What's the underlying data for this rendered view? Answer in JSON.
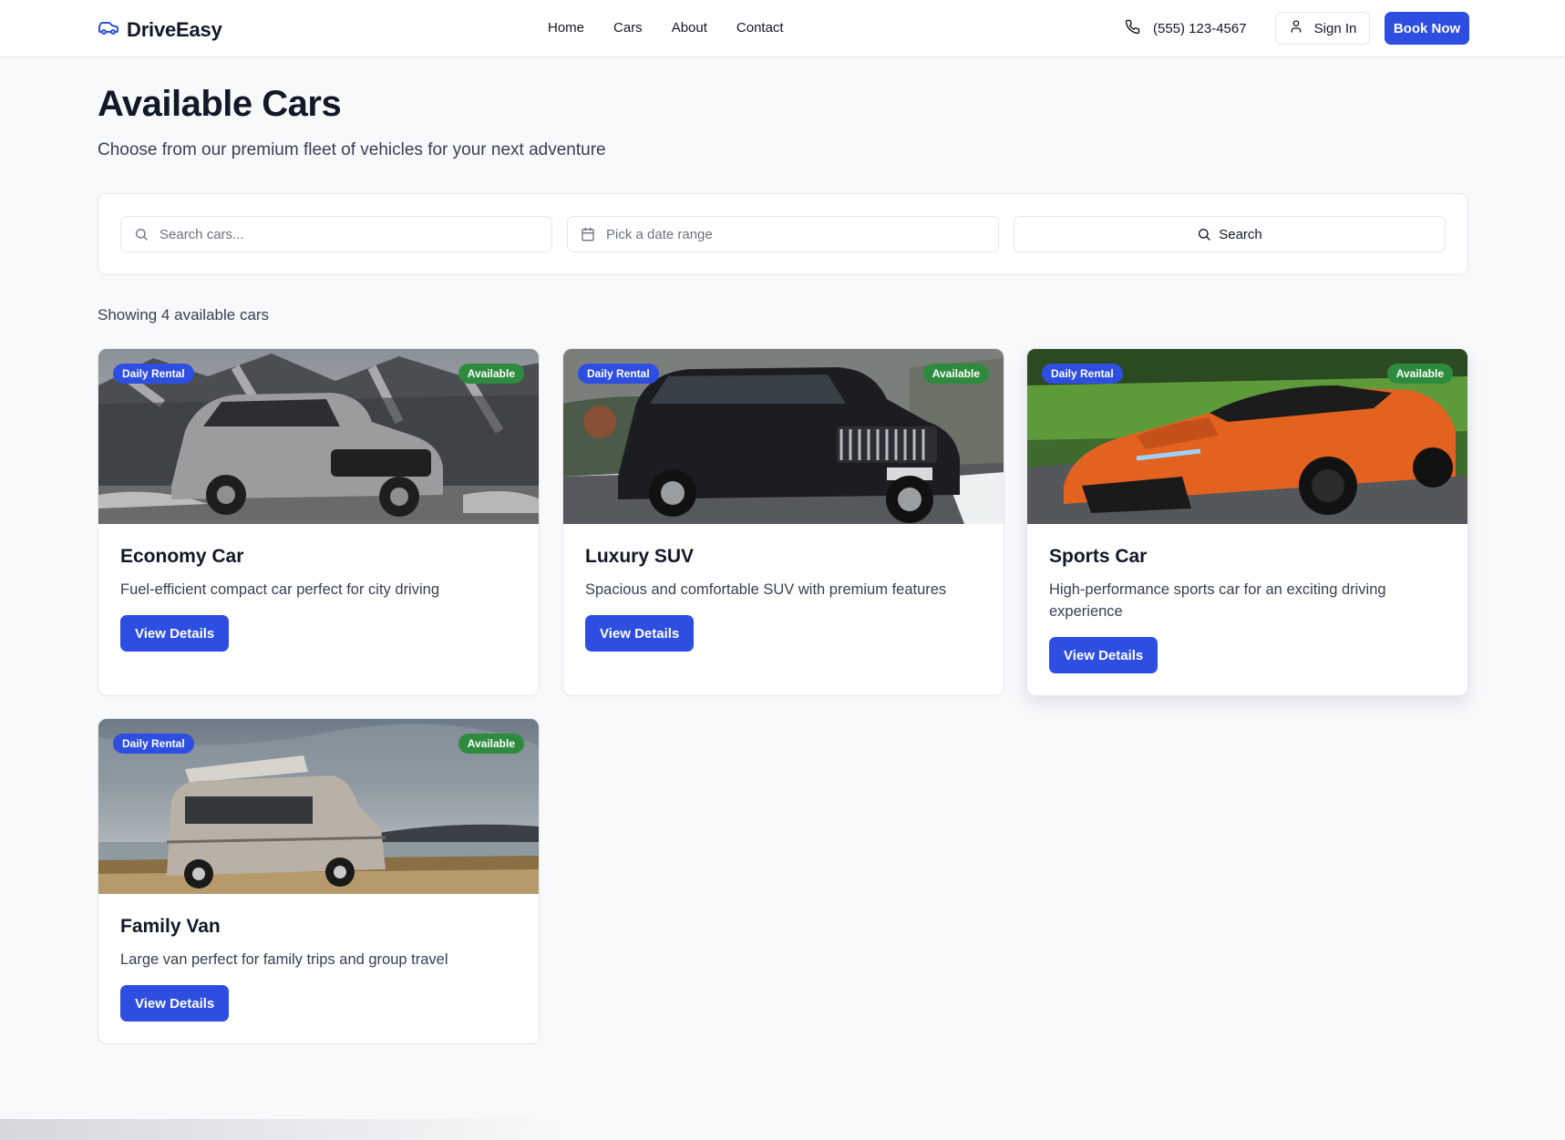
{
  "header": {
    "brand": "DriveEasy",
    "nav": [
      "Home",
      "Cars",
      "About",
      "Contact"
    ],
    "phone": "(555) 123-4567",
    "sign_in": "Sign In",
    "book_now": "Book Now"
  },
  "main": {
    "title": "Available Cars",
    "subtitle": "Choose from our premium fleet of vehicles for your next adventure",
    "count_text": "Showing 4 available cars"
  },
  "search": {
    "placeholder": "Search cars...",
    "date_placeholder": "Pick a date range",
    "button": "Search"
  },
  "cars": [
    {
      "title": "Economy Car",
      "description": "Fuel-efficient compact car perfect for city driving",
      "rental_badge": "Daily Rental",
      "status_badge": "Available",
      "button": "View Details"
    },
    {
      "title": "Luxury SUV",
      "description": "Spacious and comfortable SUV with premium features",
      "rental_badge": "Daily Rental",
      "status_badge": "Available",
      "button": "View Details"
    },
    {
      "title": "Sports Car",
      "description": "High-performance sports car for an exciting driving experience",
      "rental_badge": "Daily Rental",
      "status_badge": "Available",
      "button": "View Details"
    },
    {
      "title": "Family Van",
      "description": "Large van perfect for family trips and group travel",
      "rental_badge": "Daily Rental",
      "status_badge": "Available",
      "button": "View Details"
    }
  ],
  "colors": {
    "primary": "#2d4ee0",
    "available": "#2e8b3e",
    "background": "#f8f9fb"
  },
  "icons": [
    "car-icon",
    "phone-icon",
    "user-icon",
    "search-icon",
    "calendar-icon"
  ]
}
